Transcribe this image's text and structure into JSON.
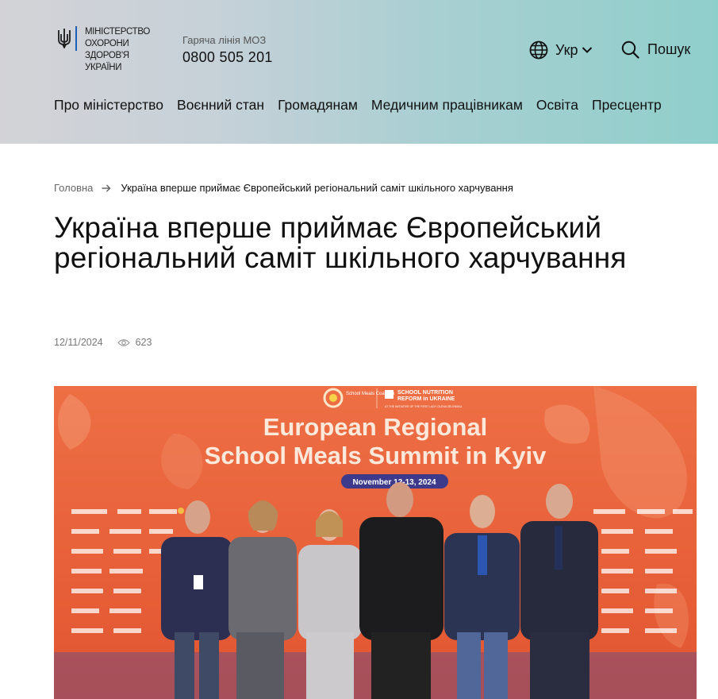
{
  "header": {
    "logo": {
      "lines": [
        "Міністерство",
        "охорони",
        "здоров'я",
        "України"
      ]
    },
    "hotline": {
      "label": "Гаряча лінія МОЗ",
      "number": "0800 505 201"
    },
    "language": {
      "label": "Укр",
      "icon": "globe-icon"
    },
    "search": {
      "label": "Пошук",
      "icon": "search-icon"
    },
    "nav": [
      {
        "label": "Про міністерство"
      },
      {
        "label": "Воєнний стан"
      },
      {
        "label": "Громадянам"
      },
      {
        "label": "Медичним працівникам"
      },
      {
        "label": "Освіта"
      },
      {
        "label": "Пресцентр"
      }
    ],
    "colors": {
      "gradient_start": "#d3d3d7",
      "gradient_end": "#8fcfcb"
    }
  },
  "breadcrumb": {
    "home": "Головна",
    "current": "Україна вперше приймає Європейський регіональний саміт шкільного харчування"
  },
  "article": {
    "title": "Україна вперше приймає Європейський регіональний саміт шкільного харчування",
    "date": "12/11/2024",
    "views": "623",
    "photo": {
      "backdrop_title_line1": "European Regional",
      "backdrop_title_line2": "School Meals Summit in Kyiv",
      "backdrop_date": "November 12-13, 2024",
      "backdrop_logo_left": "School Meals Coalition",
      "backdrop_logo_right_line1": "SCHOOL NUTRITION",
      "backdrop_logo_right_line2": "REFORM in UKRAINE",
      "backdrop_logo_right_sub": "AT THE INITIATIVE OF THE FIRST LADY OLENA ZELENSKA",
      "accent_color": "#e8623a"
    }
  }
}
